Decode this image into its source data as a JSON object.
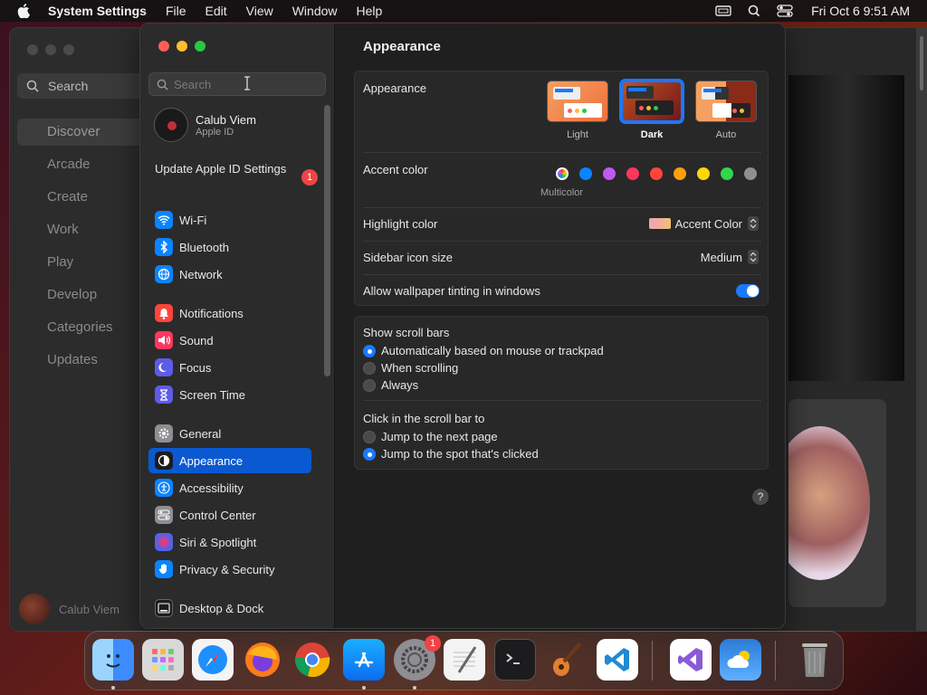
{
  "menubar": {
    "app_name": "System Settings",
    "menus": [
      "File",
      "Edit",
      "View",
      "Window",
      "Help"
    ],
    "clock": "Fri Oct 6  9:51 AM"
  },
  "background_app": {
    "search_placeholder": "Search",
    "nav": [
      "Discover",
      "Arcade",
      "Create",
      "Work",
      "Play",
      "Develop",
      "Categories",
      "Updates"
    ],
    "user_name": "Calub Viem"
  },
  "sidebar": {
    "search_placeholder": "Search",
    "account": {
      "name": "Calub Viem",
      "sub": "Apple ID"
    },
    "update": {
      "label": "Update Apple ID Settings",
      "badge": "1"
    },
    "items": [
      {
        "label": "Wi-Fi",
        "icon": "wifi-icon",
        "color": "#0a84ff"
      },
      {
        "label": "Bluetooth",
        "icon": "bluetooth-icon",
        "color": "#0a84ff"
      },
      {
        "label": "Network",
        "icon": "globe-icon",
        "color": "#0a84ff"
      },
      {
        "label": "Notifications",
        "icon": "bell-icon",
        "color": "#ff453a"
      },
      {
        "label": "Sound",
        "icon": "speaker-icon",
        "color": "#ff375f"
      },
      {
        "label": "Focus",
        "icon": "moon-icon",
        "color": "#5e5ce6"
      },
      {
        "label": "Screen Time",
        "icon": "hourglass-icon",
        "color": "#5e5ce6"
      },
      {
        "label": "General",
        "icon": "gear-icon",
        "color": "#8e8e93"
      },
      {
        "label": "Appearance",
        "icon": "appearance-icon",
        "color": "#1c1c1e"
      },
      {
        "label": "Accessibility",
        "icon": "accessibility-icon",
        "color": "#0a84ff"
      },
      {
        "label": "Control Center",
        "icon": "control-center-icon",
        "color": "#8e8e93"
      },
      {
        "label": "Siri & Spotlight",
        "icon": "siri-icon",
        "color": "#bf5af2"
      },
      {
        "label": "Privacy & Security",
        "icon": "hand-icon",
        "color": "#0a84ff"
      },
      {
        "label": "Desktop & Dock",
        "icon": "dock-icon",
        "color": "#1c1c1e"
      }
    ]
  },
  "content": {
    "title": "Appearance",
    "appearance": {
      "label": "Appearance",
      "options": [
        {
          "label": "Light",
          "selected": false
        },
        {
          "label": "Dark",
          "selected": true
        },
        {
          "label": "Auto",
          "selected": false
        }
      ]
    },
    "accent": {
      "label": "Accent color",
      "selected_label": "Multicolor",
      "colors": [
        "multicolor",
        "#0a84ff",
        "#bf5af2",
        "#ff375f",
        "#ff453a",
        "#ff9f0a",
        "#ffd60a",
        "#32d74b",
        "#8e8e93"
      ]
    },
    "highlight": {
      "label": "Highlight color",
      "value": "Accent Color"
    },
    "icon_size": {
      "label": "Sidebar icon size",
      "value": "Medium"
    },
    "tinting": {
      "label": "Allow wallpaper tinting in windows",
      "enabled": true
    },
    "scroll_bars": {
      "label": "Show scroll bars",
      "options": [
        {
          "label": "Automatically based on mouse or trackpad",
          "selected": true
        },
        {
          "label": "When scrolling",
          "selected": false
        },
        {
          "label": "Always",
          "selected": false
        }
      ]
    },
    "click_scroll": {
      "label": "Click in the scroll bar to",
      "options": [
        {
          "label": "Jump to the next page",
          "selected": false
        },
        {
          "label": "Jump to the spot that's clicked",
          "selected": true
        }
      ]
    },
    "help": "?"
  },
  "dock": {
    "apps": [
      "Finder",
      "Launchpad",
      "Safari",
      "Firefox",
      "Chrome",
      "App Store",
      "System Settings",
      "TextEdit",
      "Terminal",
      "GarageBand",
      "Visual Studio Code",
      "Visual Studio",
      "Weather",
      "Trash"
    ],
    "settings_badge": "1"
  }
}
